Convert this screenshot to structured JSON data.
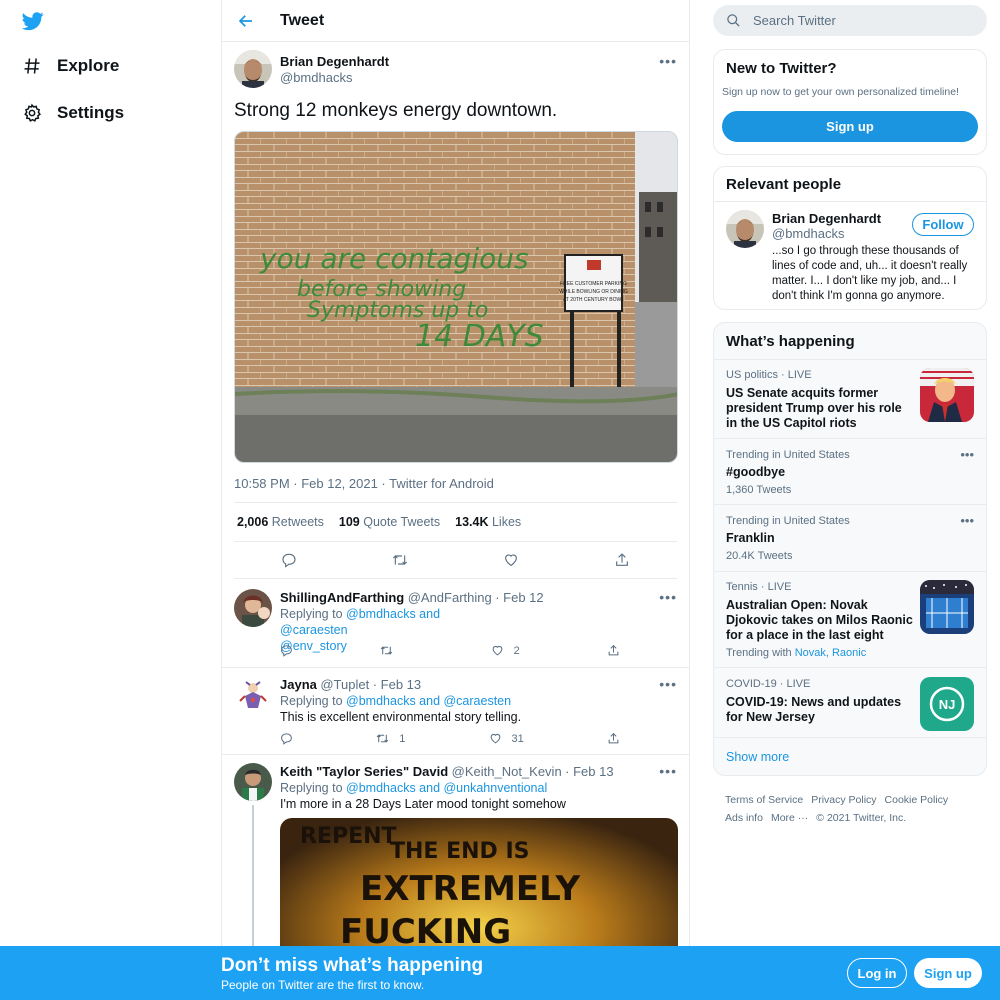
{
  "nav": {
    "items": [
      {
        "label": "Explore",
        "icon": "hashtag-icon"
      },
      {
        "label": "Settings",
        "icon": "gear-icon"
      }
    ]
  },
  "header": {
    "title": "Tweet"
  },
  "tweet": {
    "author_name": "Brian Degenhardt",
    "author_handle": "@bmdhacks",
    "text": "Strong 12 monkeys energy downtown.",
    "graffiti": [
      "you are contagious",
      "before showing",
      "Symptoms up to",
      "14 DAYS"
    ],
    "sign_text": [
      "FREE CUSTOMER PARKING",
      "WHILE BOWLING OR DINING",
      "AT 20TH CENTURY BOWL"
    ],
    "meta": "10:58 PM · Feb 12, 2021 · Twitter for Android",
    "retweets": "2,006",
    "retweets_label": "Retweets",
    "quotes": "109",
    "quotes_label": "Quote Tweets",
    "likes": "13.4K",
    "likes_label": "Likes"
  },
  "replies": [
    {
      "name": "ShillingAndFarthing",
      "handle": "@AndFarthing",
      "date": "· Feb 12",
      "replying_prefix": "Replying to",
      "replying_to": "@bmdhacks and @caraesten",
      "replying_to_2": "@env_story",
      "text": "",
      "retweets": "",
      "likes": "2"
    },
    {
      "name": "Jayna",
      "handle": "@Tuplet",
      "date": "· Feb 13",
      "replying_prefix": "Replying to",
      "replying_to": "@bmdhacks and @caraesten",
      "text": "This is excellent environmental story telling.",
      "retweets": "1",
      "likes": "31"
    },
    {
      "name": "Keith \"Taylor Series\" David",
      "handle": "@Keith_Not_Kevin",
      "date": "· Feb 13",
      "replying_prefix": "Replying to",
      "replying_to": "@bmdhacks and @unkahnventional",
      "text": "I'm more in a 28 Days Later mood tonight somehow",
      "media_text": [
        "REPENT",
        "THE END IS",
        "EXTREMELY",
        "FUCKING"
      ]
    }
  ],
  "search": {
    "placeholder": "Search Twitter"
  },
  "new_to_twitter": {
    "title": "New to Twitter?",
    "subtitle": "Sign up now to get your own personalized timeline!",
    "button": "Sign up"
  },
  "relevant_people": {
    "title": "Relevant people",
    "name": "Brian Degenhardt",
    "handle": "@bmdhacks",
    "follow": "Follow",
    "bio": "...so I go through these thousands of lines of code and, uh... it doesn't really matter. I... I don't like my job, and... I don't think I'm gonna go anymore."
  },
  "whats_happening": {
    "title": "What’s happening",
    "trends": [
      {
        "context": "US politics · LIVE",
        "title": "US Senate acquits former president Trump over his role in the US Capitol riots"
      },
      {
        "context": "Trending in United States",
        "title": "#goodbye",
        "sub": "1,360 Tweets"
      },
      {
        "context": "Trending in United States",
        "title": "Franklin",
        "sub": "20.4K Tweets"
      },
      {
        "context": "Tennis · LIVE",
        "title": "Australian Open: Novak Djokovic takes on Milos Raonic for a place in the last eight",
        "sub_prefix": "Trending with",
        "sub_links": "Novak, Raonic"
      },
      {
        "context": "COVID-19 · LIVE",
        "title": "COVID-19: News and updates for New Jersey",
        "thumb_text": "NJ"
      }
    ],
    "show_more": "Show more"
  },
  "footer": {
    "links": [
      "Terms of Service",
      "Privacy Policy",
      "Cookie Policy",
      "Ads info",
      "More ···"
    ],
    "copyright": "© 2021 Twitter, Inc."
  },
  "bottom_bar": {
    "title": "Don’t miss what’s happening",
    "subtitle": "People on Twitter are the first to know.",
    "login": "Log in",
    "signup": "Sign up"
  },
  "colors": {
    "accent": "#1b95e0",
    "bottom_bar": "#1da1f2",
    "text": "#0f1419",
    "secondary": "#5b7083",
    "border": "#e6ecf0"
  }
}
